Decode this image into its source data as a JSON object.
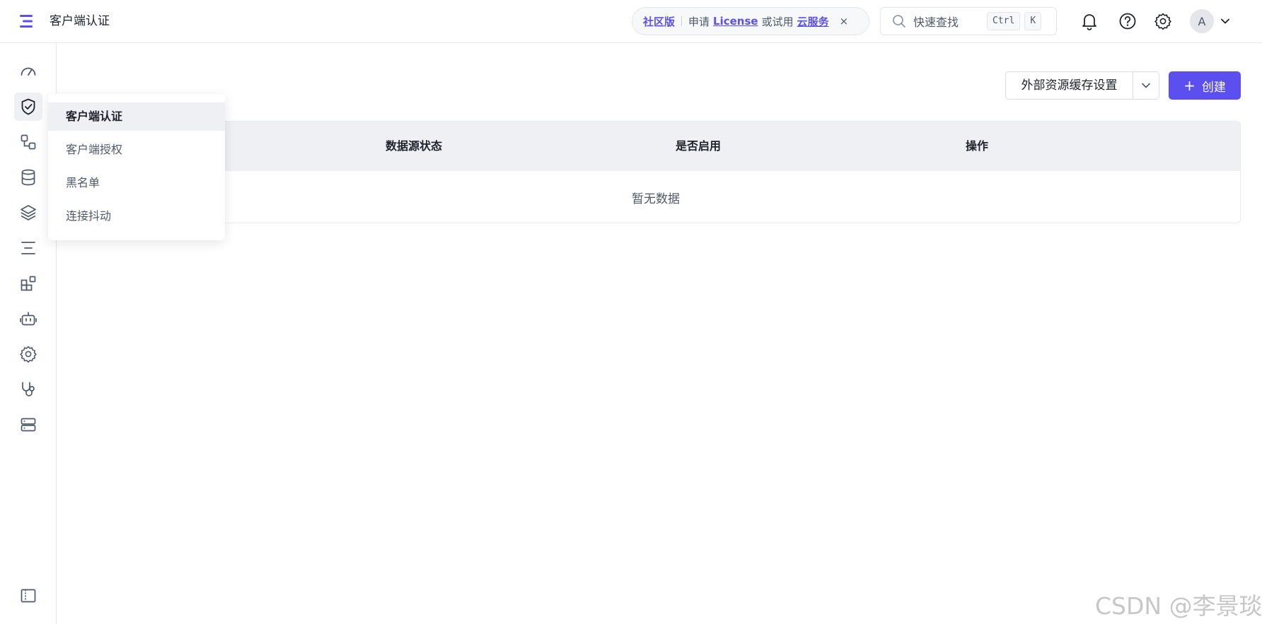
{
  "header": {
    "app_title": "客户端认证",
    "banner": {
      "edition": "社区版",
      "apply_text": "申请",
      "license_link": "License",
      "or_try_text": "或试用",
      "cloud_link": "云服务",
      "close_glyph": "×"
    },
    "search": {
      "placeholder": "快速查找",
      "shortcut_ctrl": "Ctrl",
      "shortcut_key": "K"
    },
    "icons": [
      "bell-icon",
      "help-icon",
      "settings-icon"
    ],
    "avatar_letter": "A"
  },
  "sidebar": {
    "items": [
      {
        "icon": "dashboard-icon"
      },
      {
        "icon": "shield-check-icon",
        "active": true
      },
      {
        "icon": "workflow-icon"
      },
      {
        "icon": "database-icon"
      },
      {
        "icon": "layers-icon"
      },
      {
        "icon": "list-icon"
      },
      {
        "icon": "extensions-icon"
      },
      {
        "icon": "robot-icon"
      },
      {
        "icon": "gear-icon"
      },
      {
        "icon": "stethoscope-icon"
      },
      {
        "icon": "server-icon"
      }
    ],
    "footer_icon": "sidebar-collapse-icon"
  },
  "popup_menu": {
    "items": [
      {
        "label": "客户端认证",
        "active": true
      },
      {
        "label": "客户端授权"
      },
      {
        "label": "黑名单"
      },
      {
        "label": "连接抖动"
      }
    ]
  },
  "toolbar": {
    "cache_settings_label": "外部资源缓存设置",
    "create_label": "创建"
  },
  "table": {
    "columns": [
      "数据源状态",
      "是否启用",
      "操作"
    ],
    "empty_text": "暂无数据"
  },
  "watermark": "CSDN @李景琰",
  "colors": {
    "accent": "#5b4ff0",
    "header_bg": "#eef0f4",
    "text": "#1f2329",
    "muted": "#4e5969"
  }
}
